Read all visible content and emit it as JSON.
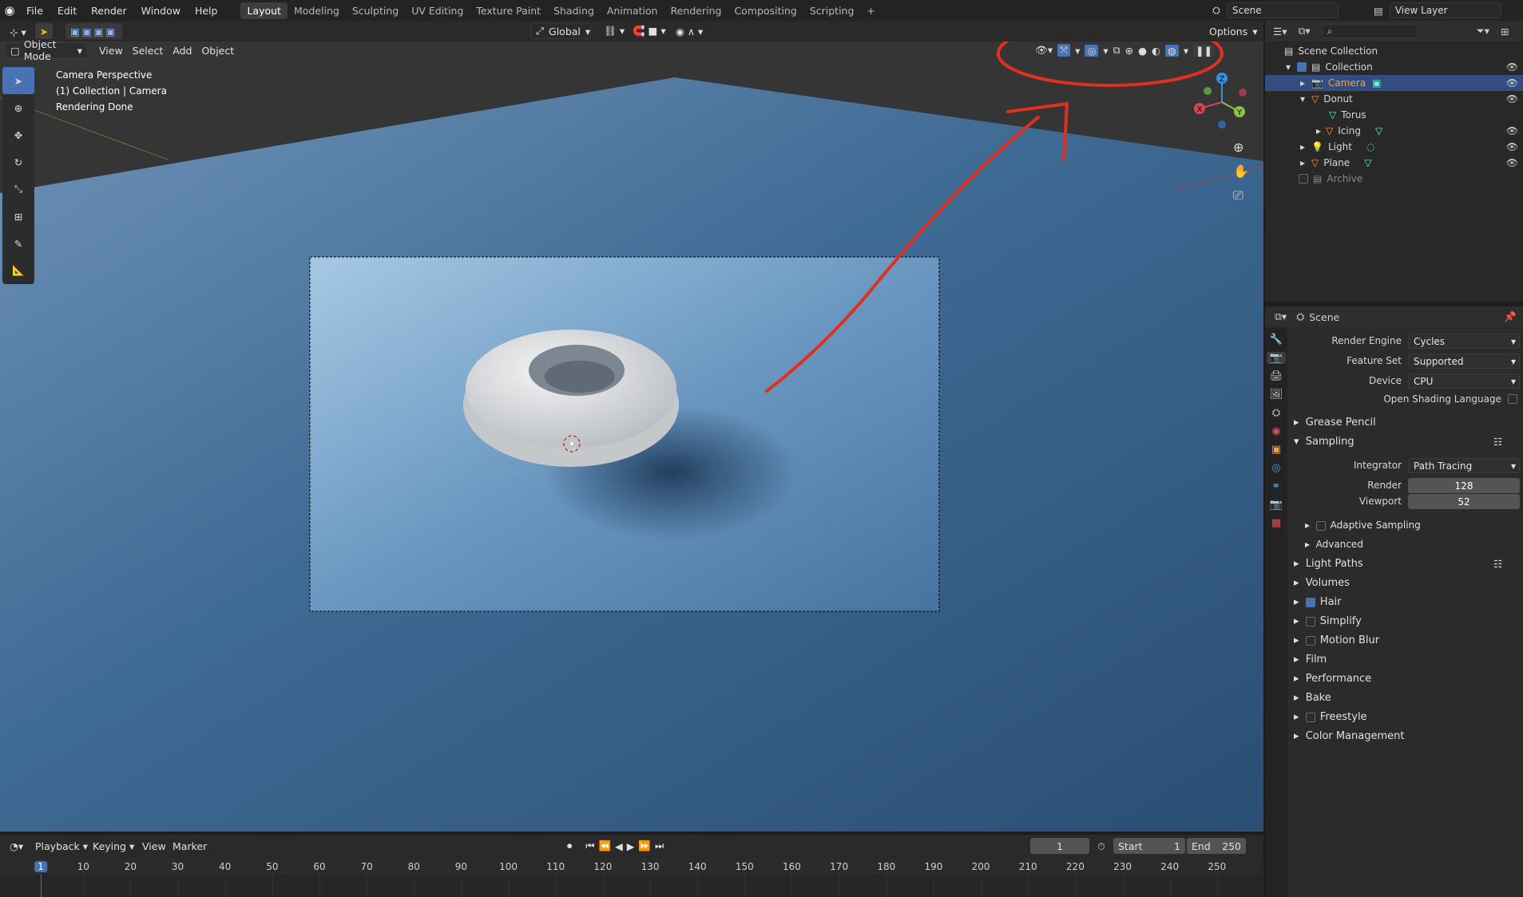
{
  "topbar": {
    "menus": [
      "File",
      "Edit",
      "Render",
      "Window",
      "Help"
    ],
    "workspaces": [
      "Layout",
      "Modeling",
      "Sculpting",
      "UV Editing",
      "Texture Paint",
      "Shading",
      "Animation",
      "Rendering",
      "Compositing",
      "Scripting"
    ],
    "active_workspace": "Layout",
    "add_tab": "+",
    "scene": "Scene",
    "view_layer": "View Layer"
  },
  "viewport": {
    "mode": "Object Mode",
    "menus": [
      "View",
      "Select",
      "Add",
      "Object"
    ],
    "orientation": "Global",
    "options": "Options",
    "overlay_lines": [
      "Camera Perspective",
      "(1) Collection | Camera",
      "Rendering Done"
    ],
    "gizmo": {
      "x": "X",
      "y": "Y",
      "z": "Z"
    }
  },
  "outliner": {
    "root": "Scene Collection",
    "items": [
      {
        "name": "Collection",
        "level": 1
      },
      {
        "name": "Camera",
        "level": 2
      },
      {
        "name": "Donut",
        "level": 2
      },
      {
        "name": "Torus",
        "level": 3
      },
      {
        "name": "Icing",
        "level": 3
      },
      {
        "name": "Light",
        "level": 2
      },
      {
        "name": "Plane",
        "level": 2
      },
      {
        "name": "Archive",
        "level": 1
      }
    ]
  },
  "properties": {
    "title": "Scene",
    "render_engine_label": "Render Engine",
    "render_engine": "Cycles",
    "feature_set_label": "Feature Set",
    "feature_set": "Supported",
    "device_label": "Device",
    "device": "CPU",
    "osl_label": "Open Shading Language",
    "sections": [
      "Grease Pencil",
      "Sampling",
      "Light Paths",
      "Volumes",
      "Hair",
      "Simplify",
      "Motion Blur",
      "Film",
      "Performance",
      "Bake",
      "Freestyle",
      "Color Management"
    ],
    "integrator_label": "Integrator",
    "integrator": "Path Tracing",
    "render_label": "Render",
    "render_samples": "128",
    "viewport_label": "Viewport",
    "viewport_samples": "52",
    "adaptive_sampling": "Adaptive Sampling",
    "advanced": "Advanced"
  },
  "timeline": {
    "menus": [
      "Playback",
      "Keying",
      "View",
      "Marker"
    ],
    "current_frame": "1",
    "start_label": "Start",
    "start": "1",
    "end_label": "End",
    "end": "250",
    "ticks": [
      "1",
      "10",
      "20",
      "30",
      "40",
      "50",
      "60",
      "70",
      "80",
      "90",
      "100",
      "110",
      "120",
      "130",
      "140",
      "150",
      "160",
      "170",
      "180",
      "190",
      "200",
      "210",
      "220",
      "230",
      "240",
      "250"
    ]
  },
  "colors": {
    "accent": "#4772b3",
    "annotation": "#e0301e",
    "header": "#2a2a2a"
  }
}
